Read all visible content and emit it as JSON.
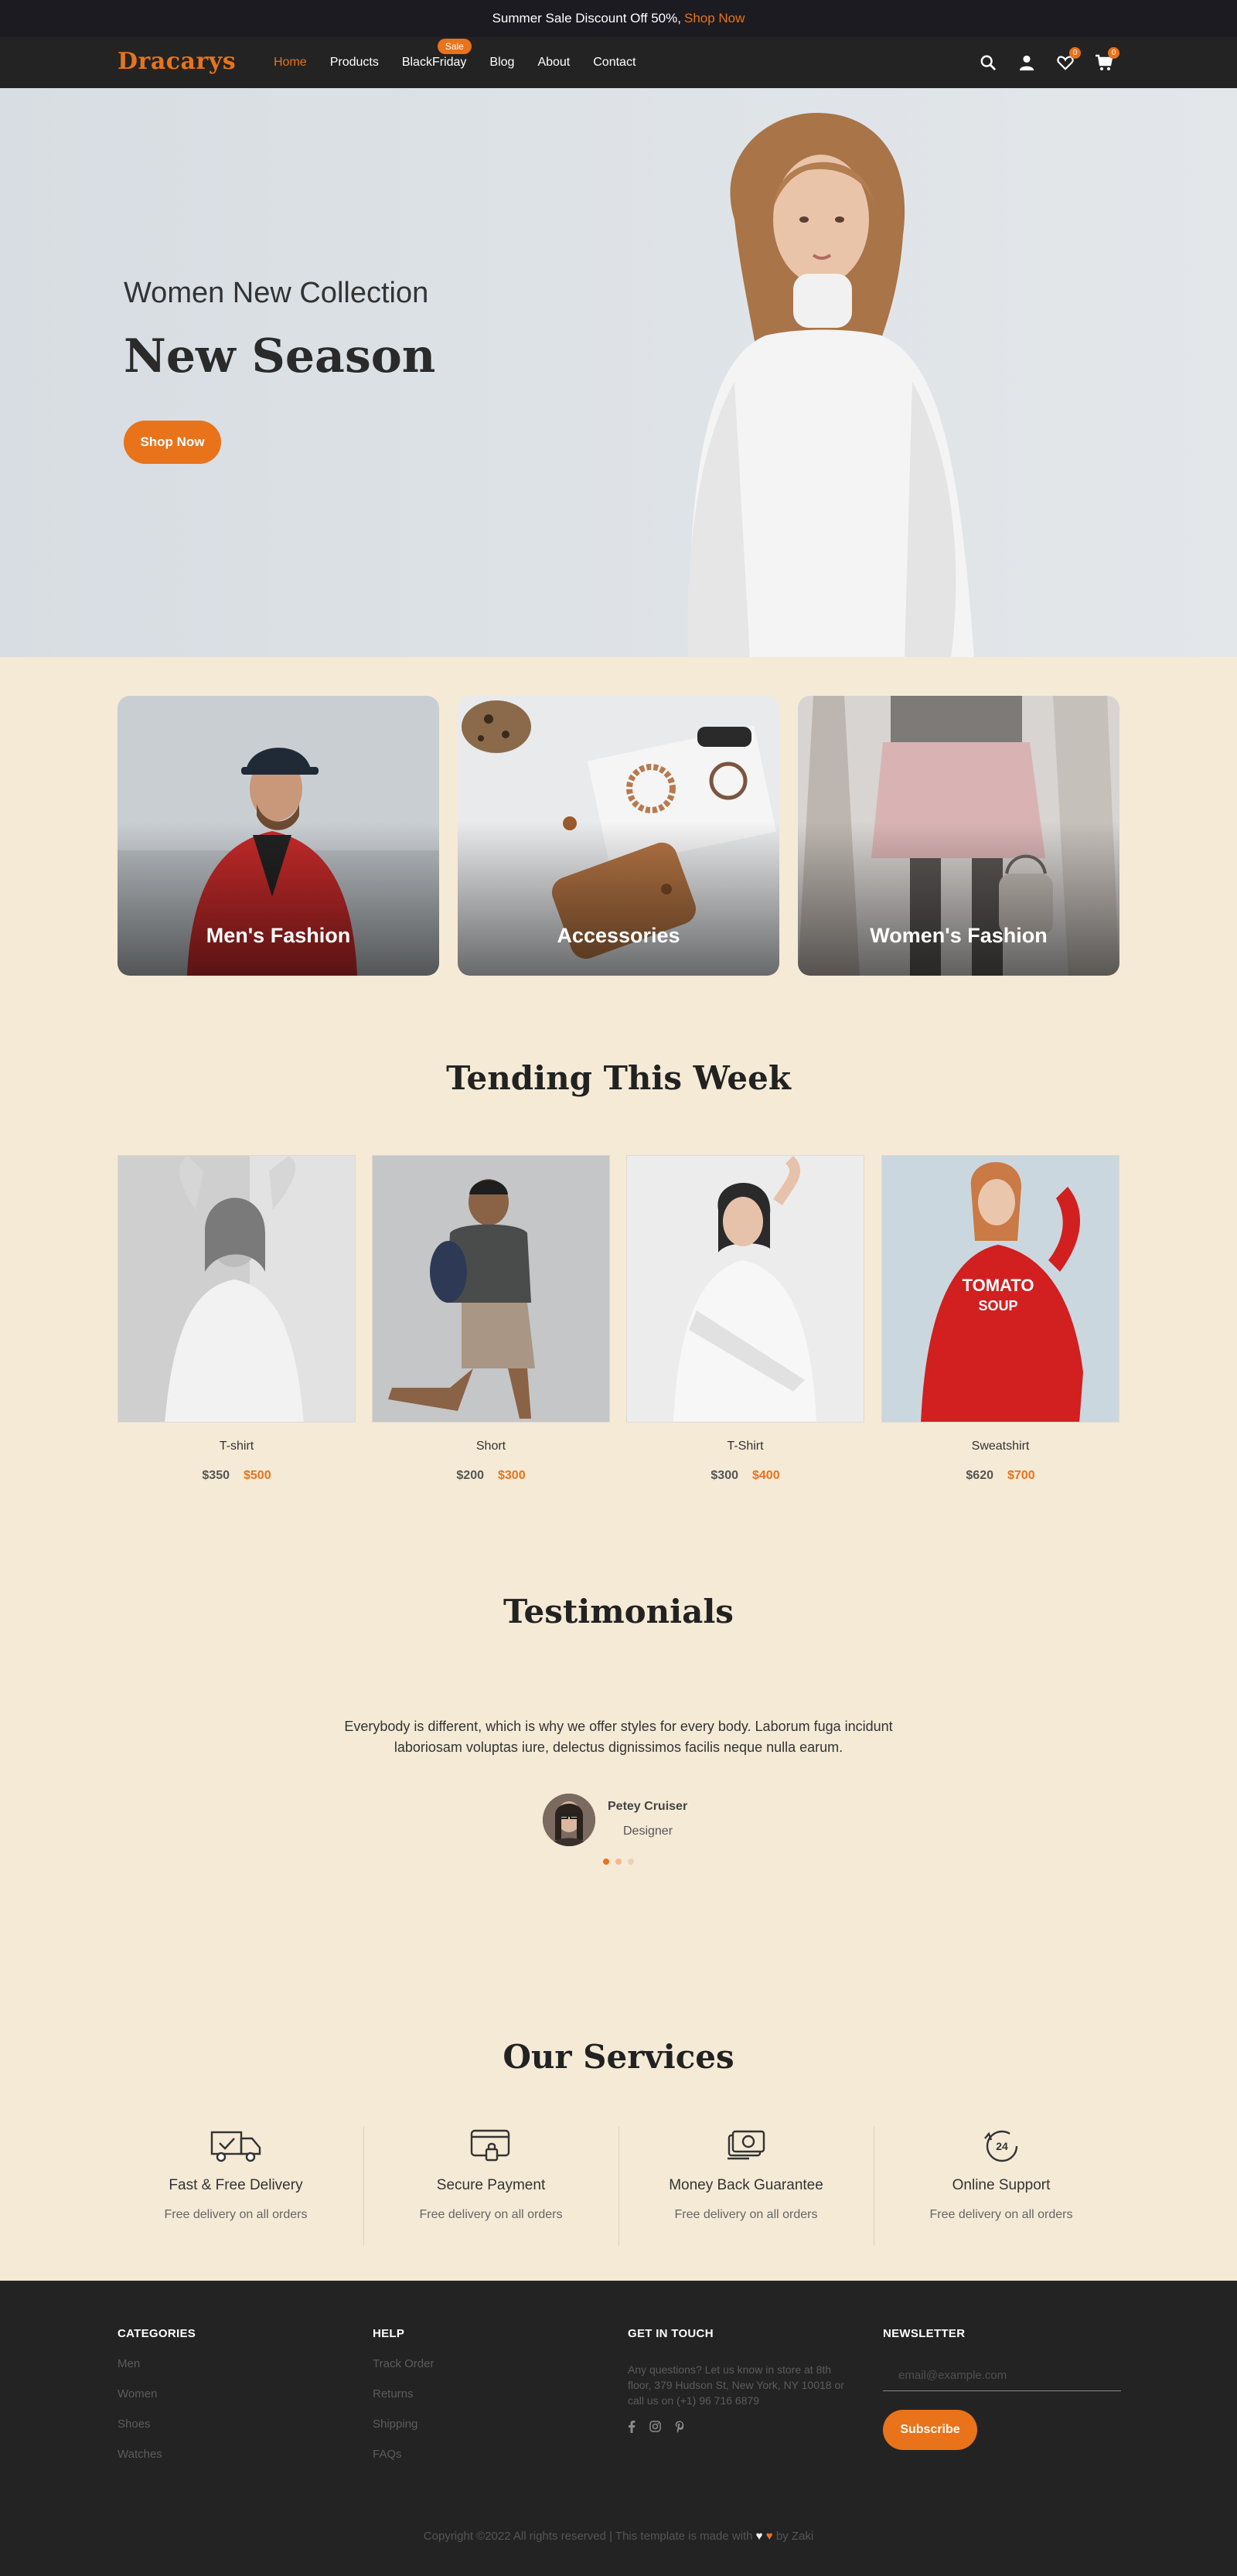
{
  "announcement": {
    "text": "Summer Sale Discount Off 50%,",
    "link": "Shop Now"
  },
  "header": {
    "logo": "Dracarys",
    "nav": [
      "Home",
      "Products",
      "BlackFriday",
      "Blog",
      "About",
      "Contact"
    ],
    "sale_badge": "Sale",
    "wishlist_count": "0",
    "cart_count": "0"
  },
  "hero": {
    "subtitle": "Women New Collection",
    "title": "New Season",
    "button": "Shop Now"
  },
  "categories": [
    {
      "label": "Men's Fashion"
    },
    {
      "label": "Accessories"
    },
    {
      "label": "Women's Fashion"
    }
  ],
  "trending": {
    "title": "Tending This Week",
    "products": [
      {
        "name": "T-shirt",
        "old_price": "$350",
        "price": "$500"
      },
      {
        "name": "Short",
        "old_price": "$200",
        "price": "$300"
      },
      {
        "name": "T-Shirt",
        "old_price": "$300",
        "price": "$400"
      },
      {
        "name": "Sweatshirt",
        "old_price": "$620",
        "price": "$700"
      }
    ]
  },
  "testimonials": {
    "title": "Testimonials",
    "quote": "Everybody is different, which is why we offer styles for every body. Laborum fuga incidunt laboriosam voluptas iure, delectus dignissimos facilis neque nulla earum.",
    "name": "Petey Cruiser",
    "role": "Designer"
  },
  "services": {
    "title": "Our Services",
    "items": [
      {
        "title": "Fast & Free Delivery",
        "desc": "Free delivery on all orders",
        "icon": "delivery-truck-icon"
      },
      {
        "title": "Secure Payment",
        "desc": "Free delivery on all orders",
        "icon": "secure-card-icon"
      },
      {
        "title": "Money Back Guarantee",
        "desc": "Free delivery on all orders",
        "icon": "money-back-icon"
      },
      {
        "title": "Online Support",
        "desc": "Free delivery on all orders",
        "icon": "support-24-icon"
      }
    ]
  },
  "footer": {
    "categories": {
      "title": "CATEGORIES",
      "links": [
        "Men",
        "Women",
        "Shoes",
        "Watches"
      ]
    },
    "help": {
      "title": "HELP",
      "links": [
        "Track Order",
        "Returns",
        "Shipping",
        "FAQs"
      ]
    },
    "contact": {
      "title": "GET IN TOUCH",
      "text": "Any questions? Let us know in store at 8th floor, 379 Hudson St, New York, NY 10018 or call us on (+1) 96 716 6879"
    },
    "newsletter": {
      "title": "NEWSLETTER",
      "placeholder": "email@example.com",
      "button": "Subscribe"
    },
    "copyright_prefix": "Copyright ©2022 All rights reserved | This template is made with",
    "copyright_suffix": "by Zaki"
  },
  "colors": {
    "accent": "#e8731a",
    "background": "#f5ead6",
    "dark": "#232323"
  }
}
